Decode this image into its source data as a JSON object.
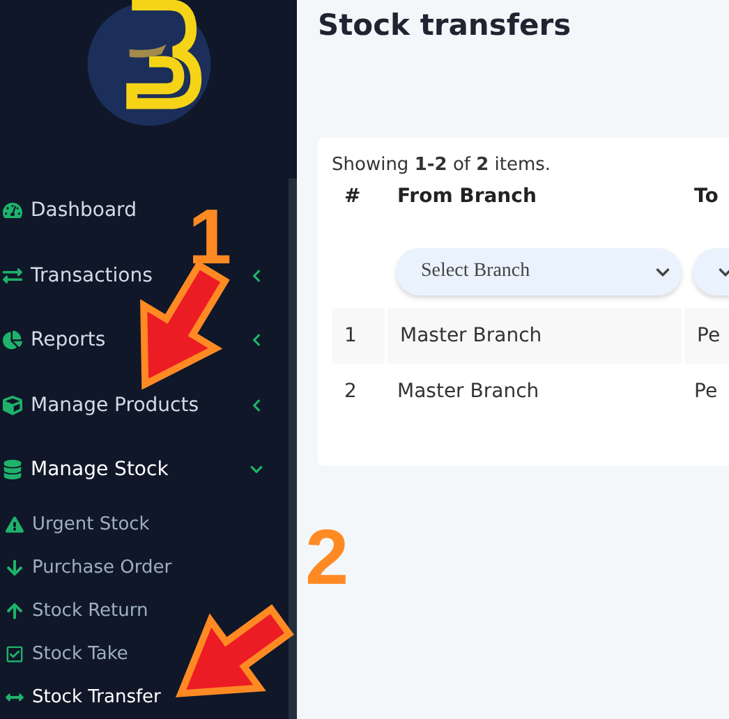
{
  "sidebar": {
    "items": [
      {
        "label": "Dashboard"
      },
      {
        "label": "Transactions",
        "expanded": false
      },
      {
        "label": "Reports",
        "expanded": false
      },
      {
        "label": "Manage Products",
        "expanded": false
      },
      {
        "label": "Manage Stock",
        "expanded": true,
        "children": [
          {
            "label": "Urgent Stock",
            "selected": false
          },
          {
            "label": "Purchase Order",
            "selected": false
          },
          {
            "label": "Stock Return",
            "selected": false
          },
          {
            "label": "Stock Take",
            "selected": false
          },
          {
            "label": "Stock Transfer",
            "selected": true
          }
        ]
      }
    ]
  },
  "page": {
    "title": "Stock transfers"
  },
  "table": {
    "summary": "Showing **1-2** of **2** items.",
    "columns": [
      {
        "label": "#",
        "filter": false
      },
      {
        "label": "From Branch",
        "filter": true,
        "placeholder": "Select Branch"
      },
      {
        "label": "To",
        "filter": true
      }
    ],
    "rows": [
      [
        "1",
        "Master Branch",
        "Pe"
      ],
      [
        "2",
        "Master Branch",
        "Pe"
      ]
    ]
  },
  "annotations": [
    {
      "label": "1"
    },
    {
      "label": "2"
    }
  ]
}
